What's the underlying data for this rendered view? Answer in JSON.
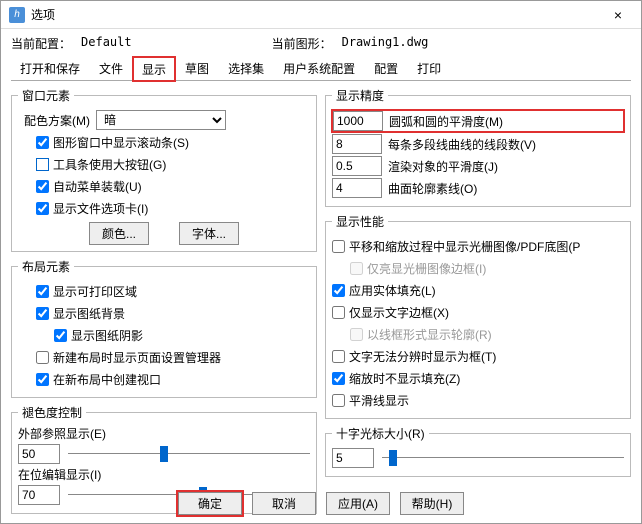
{
  "window": {
    "title": "选项",
    "close": "×"
  },
  "top": {
    "cfg_label": "当前配置：",
    "cfg_value": "Default",
    "dwg_label": "当前图形：",
    "dwg_value": "Drawing1.dwg"
  },
  "tabs": [
    "打开和保存",
    "文件",
    "显示",
    "草图",
    "选择集",
    "用户系统配置",
    "配置",
    "打印"
  ],
  "active_tab": 2,
  "winElem": {
    "legend": "窗口元素",
    "scheme_label": "配色方案(M)",
    "scheme_value": "暗",
    "show_scroll": "图形窗口中显示滚动条(S)",
    "big_tool": "工具条使用大按钮(G)",
    "auto_menu": "自动菜单装载(U)",
    "file_tabs": "显示文件选项卡(I)",
    "color_btn": "颜色...",
    "font_btn": "字体..."
  },
  "layoutElem": {
    "legend": "布局元素",
    "printable": "显示可打印区域",
    "paper_bg": "显示图纸背景",
    "shadow": "显示图纸阴影",
    "new_layout": "新建布局时显示页面设置管理器",
    "viewport": "在新布局中创建视口"
  },
  "fade": {
    "legend": "褪色度控制",
    "xref_label": "外部参照显示(E)",
    "xref_value": "50",
    "xref_pos": "38%",
    "inplace_label": "在位编辑显示(I)",
    "inplace_value": "70",
    "inplace_pos": "54%"
  },
  "precision": {
    "legend": "显示精度",
    "arc_value": "1000",
    "arc_label": "圆弧和圆的平滑度(M)",
    "seg_value": "8",
    "seg_label": "每条多段线曲线的线段数(V)",
    "render_value": "0.5",
    "render_label": "渲染对象的平滑度(J)",
    "contour_value": "4",
    "contour_label": "曲面轮廓素线(O)"
  },
  "perf": {
    "legend": "显示性能",
    "pan_raster": "平移和缩放过程中显示光栅图像/PDF底图(P",
    "hl_raster": "仅亮显光栅图像边框(I)",
    "solid_fill": "应用实体填充(L)",
    "text_frame": "仅显示文字边框(X)",
    "wire_sil": "以线框形式显示轮廓(R)",
    "text_box": "文字无法分辨时显示为框(T)",
    "zoom_fill": "缩放时不显示填充(Z)",
    "smooth_line": "平滑线显示"
  },
  "cross": {
    "legend": "十字光标大小(R)",
    "value": "5",
    "pos": "3%"
  },
  "buttons": {
    "ok": "确定",
    "cancel": "取消",
    "apply": "应用(A)",
    "help": "帮助(H)"
  }
}
